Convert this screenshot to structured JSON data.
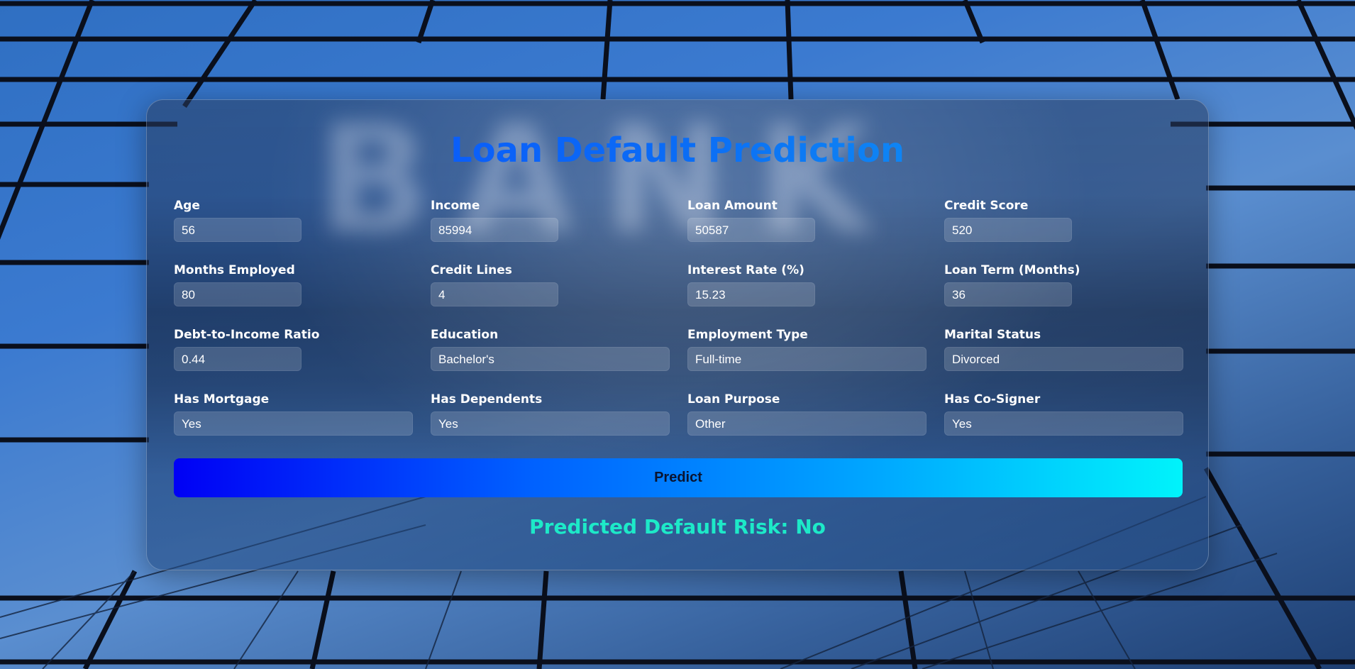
{
  "page": {
    "title": "Loan Default Prediction",
    "background_word": "BANK"
  },
  "form": {
    "fields": [
      {
        "label": "Age",
        "value": "56"
      },
      {
        "label": "Income",
        "value": "85994"
      },
      {
        "label": "Loan Amount",
        "value": "50587"
      },
      {
        "label": "Credit Score",
        "value": "520"
      },
      {
        "label": "Months Employed",
        "value": "80"
      },
      {
        "label": "Credit Lines",
        "value": "4"
      },
      {
        "label": "Interest Rate (%)",
        "value": "15.23"
      },
      {
        "label": "Loan Term (Months)",
        "value": "36"
      },
      {
        "label": "Debt-to-Income Ratio",
        "value": "0.44"
      },
      {
        "label": "Education",
        "value": "Bachelor's"
      },
      {
        "label": "Employment Type",
        "value": "Full-time"
      },
      {
        "label": "Marital Status",
        "value": "Divorced"
      },
      {
        "label": "Has Mortgage",
        "value": "Yes"
      },
      {
        "label": "Has Dependents",
        "value": "Yes"
      },
      {
        "label": "Loan Purpose",
        "value": "Other"
      },
      {
        "label": "Has Co-Signer",
        "value": "Yes"
      }
    ],
    "predict_label": "Predict"
  },
  "result": {
    "text": "Predicted Default Risk: No"
  },
  "colors": {
    "title_gradient_start": "#0a4cff",
    "title_gradient_end": "#13a6f2",
    "button_gradient_start": "#0000f5",
    "button_gradient_end": "#00f3fb",
    "result_color": "#1de9c8"
  }
}
